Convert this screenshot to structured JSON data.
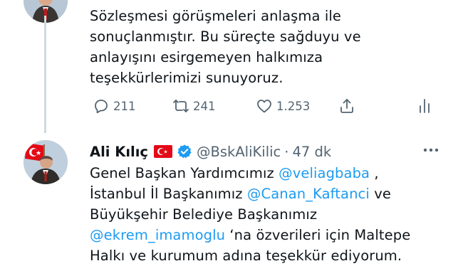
{
  "tweet1": {
    "lines": [
      "Sözleşmesi görüşmeleri anlaşma ile",
      "sonuçlanmıştır. Bu süreçte sağduyu ve",
      "anlayışını esirgemeyen halkımıza",
      "teşekkürlerimizi sunuyoruz."
    ],
    "reply_count": "211",
    "retweet_count": "241",
    "like_count": "1.253",
    "icons": [
      "reply-icon",
      "retweet-icon",
      "like-icon",
      "share-icon",
      "analytics-icon"
    ]
  },
  "tweet2": {
    "author_name": "Ali Kılıç",
    "handle": "@BskAliKilic",
    "separator": "·",
    "time": "47 dk",
    "text": {
      "l1_a": "Genel Başkan Yardımcımız ",
      "l1_mention": "@veliagbaba",
      "l1_b": " ,",
      "l2_a": "İstanbul İl Başkanımız ",
      "l2_mention": "@Canan_Kaftanci",
      "l2_b": " ve",
      "l3": "Büyükşehir Belediye Başkanımız",
      "l4_mention": "@ekrem_imamoglu",
      "l4_b": " ‘na özverileri için Maltepe",
      "l5": "Halkı ve kurumum adına teşekkür ediyorum."
    },
    "icons": [
      "turkey-flag-icon",
      "verified-badge-icon",
      "more-options-icon"
    ]
  },
  "colors": {
    "link": "#1d9bf0",
    "secondary": "#536471",
    "text": "#0f1419",
    "verified": "#1d9bf0",
    "flag": "#e30a17"
  }
}
